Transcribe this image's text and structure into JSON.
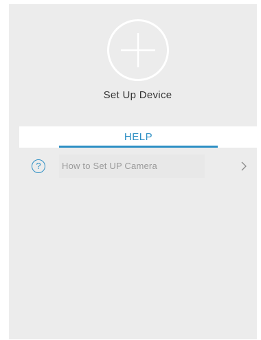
{
  "add_device": {
    "label": "Set Up Device",
    "icon": "plus-circle-icon"
  },
  "tabs": [
    {
      "label": "HELP",
      "active": true
    }
  ],
  "help_items": [
    {
      "label": "How to Set UP Camera",
      "icon": "question-circle-icon",
      "trailing_icon": "chevron-right-icon"
    }
  ],
  "colors": {
    "accent": "#2d8fc4",
    "background": "#ececec",
    "icon_white": "#ffffff"
  }
}
